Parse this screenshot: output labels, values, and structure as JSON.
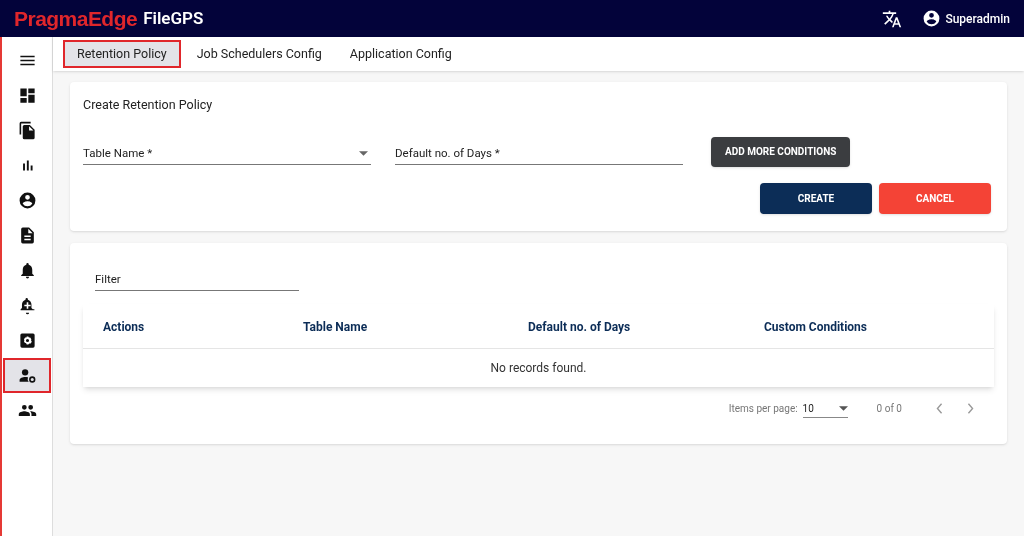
{
  "header": {
    "logo_brand": "PragmaEdge",
    "logo_product": "FileGPS",
    "user": "Superadmin"
  },
  "sidebar": {
    "items": [
      {
        "selected": false
      },
      {
        "selected": false
      },
      {
        "selected": false
      },
      {
        "selected": false
      },
      {
        "selected": false
      },
      {
        "selected": false
      },
      {
        "selected": false
      },
      {
        "selected": false
      },
      {
        "selected": false
      },
      {
        "selected": true
      },
      {
        "selected": false
      }
    ]
  },
  "tabs": [
    {
      "label": "Retention Policy",
      "selected": true
    },
    {
      "label": "Job Schedulers Config",
      "selected": false
    },
    {
      "label": "Application Config",
      "selected": false
    }
  ],
  "form": {
    "title": "Create Retention Policy",
    "table_name": {
      "placeholder": "Table Name *"
    },
    "default_days": {
      "placeholder": "Default no. of Days *"
    },
    "add_button": "ADD MORE CONDITIONS",
    "create_button": "CREATE",
    "cancel_button": "CANCEL"
  },
  "list": {
    "filter": {
      "placeholder": "Filter"
    },
    "columns": [
      "Actions",
      "Table Name",
      "Default no. of Days",
      "Custom Conditions"
    ],
    "empty_message": "No records found.",
    "paginator": {
      "label": "Items per page:",
      "page_size": "10",
      "range": "0 of 0"
    }
  }
}
